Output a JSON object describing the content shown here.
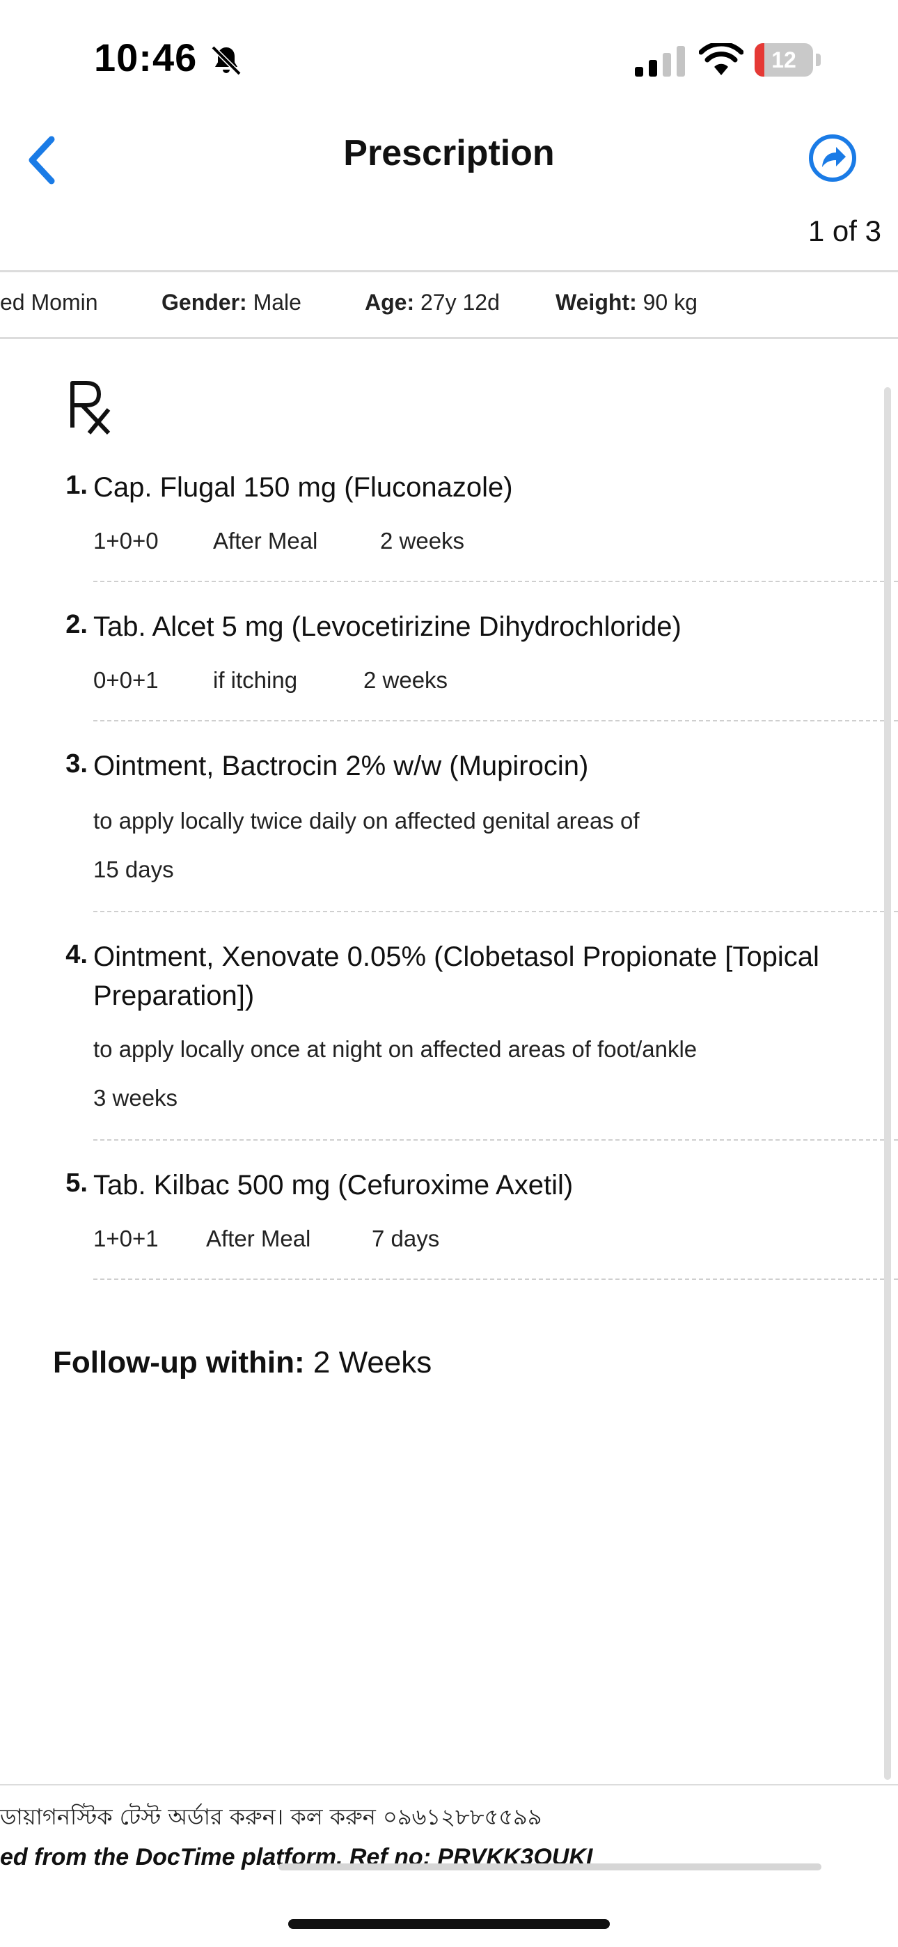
{
  "status_bar": {
    "time": "10:46",
    "battery_level": "12",
    "battery_fraction": 0.12
  },
  "header": {
    "title": "Prescription",
    "pager": "1 of 3",
    "icons": {
      "back": "chevron-left-icon",
      "share": "share-forward-icon"
    },
    "accent": "#1a7be6"
  },
  "patient": {
    "name_partial": "ed Momin",
    "gender_label": "Gender:",
    "gender_value": "Male",
    "age_label": "Age:",
    "age_value": "27y 12d",
    "weight_label": "Weight:",
    "weight_value": "90 kg"
  },
  "medicines": [
    {
      "num": "1.",
      "name": "Cap. Flugal 150 mg (Fluconazole)",
      "dose": "1+0+0",
      "timing": "After Meal",
      "duration": "2 weeks"
    },
    {
      "num": "2.",
      "name": "Tab. Alcet 5 mg (Levocetirizine Dihydrochloride)",
      "dose": "0+0+1",
      "timing": "if itching",
      "duration": "2 weeks"
    },
    {
      "num": "3.",
      "name": "Ointment, Bactrocin 2% w/w (Mupirocin)",
      "instruction": "to apply locally twice daily on affected genital areas of",
      "duration": "15 days"
    },
    {
      "num": "4.",
      "name_line1": "Ointment, Xenovate 0.05% (Clobetasol Propionate [Topical",
      "name_line2": "Preparation])",
      "instruction": "to apply locally once at night on affected areas of foot/ankle",
      "duration": "3 weeks"
    },
    {
      "num": "5.",
      "name": "Tab. Kilbac 500 mg (Cefuroxime Axetil)",
      "dose": "1+0+1",
      "timing": "After Meal",
      "duration": "7 days"
    }
  ],
  "followup": {
    "label": "Follow-up within:",
    "value": "2 Weeks"
  },
  "footer": {
    "bengali": "ডায়াগনস্টিক টেস্ট অর্ডার করুন। কল করুন ০৯৬১২৮৮৫৫৯৯",
    "ref": "ed from the DocTime platform. Ref no: PRVKK3OUKI"
  }
}
